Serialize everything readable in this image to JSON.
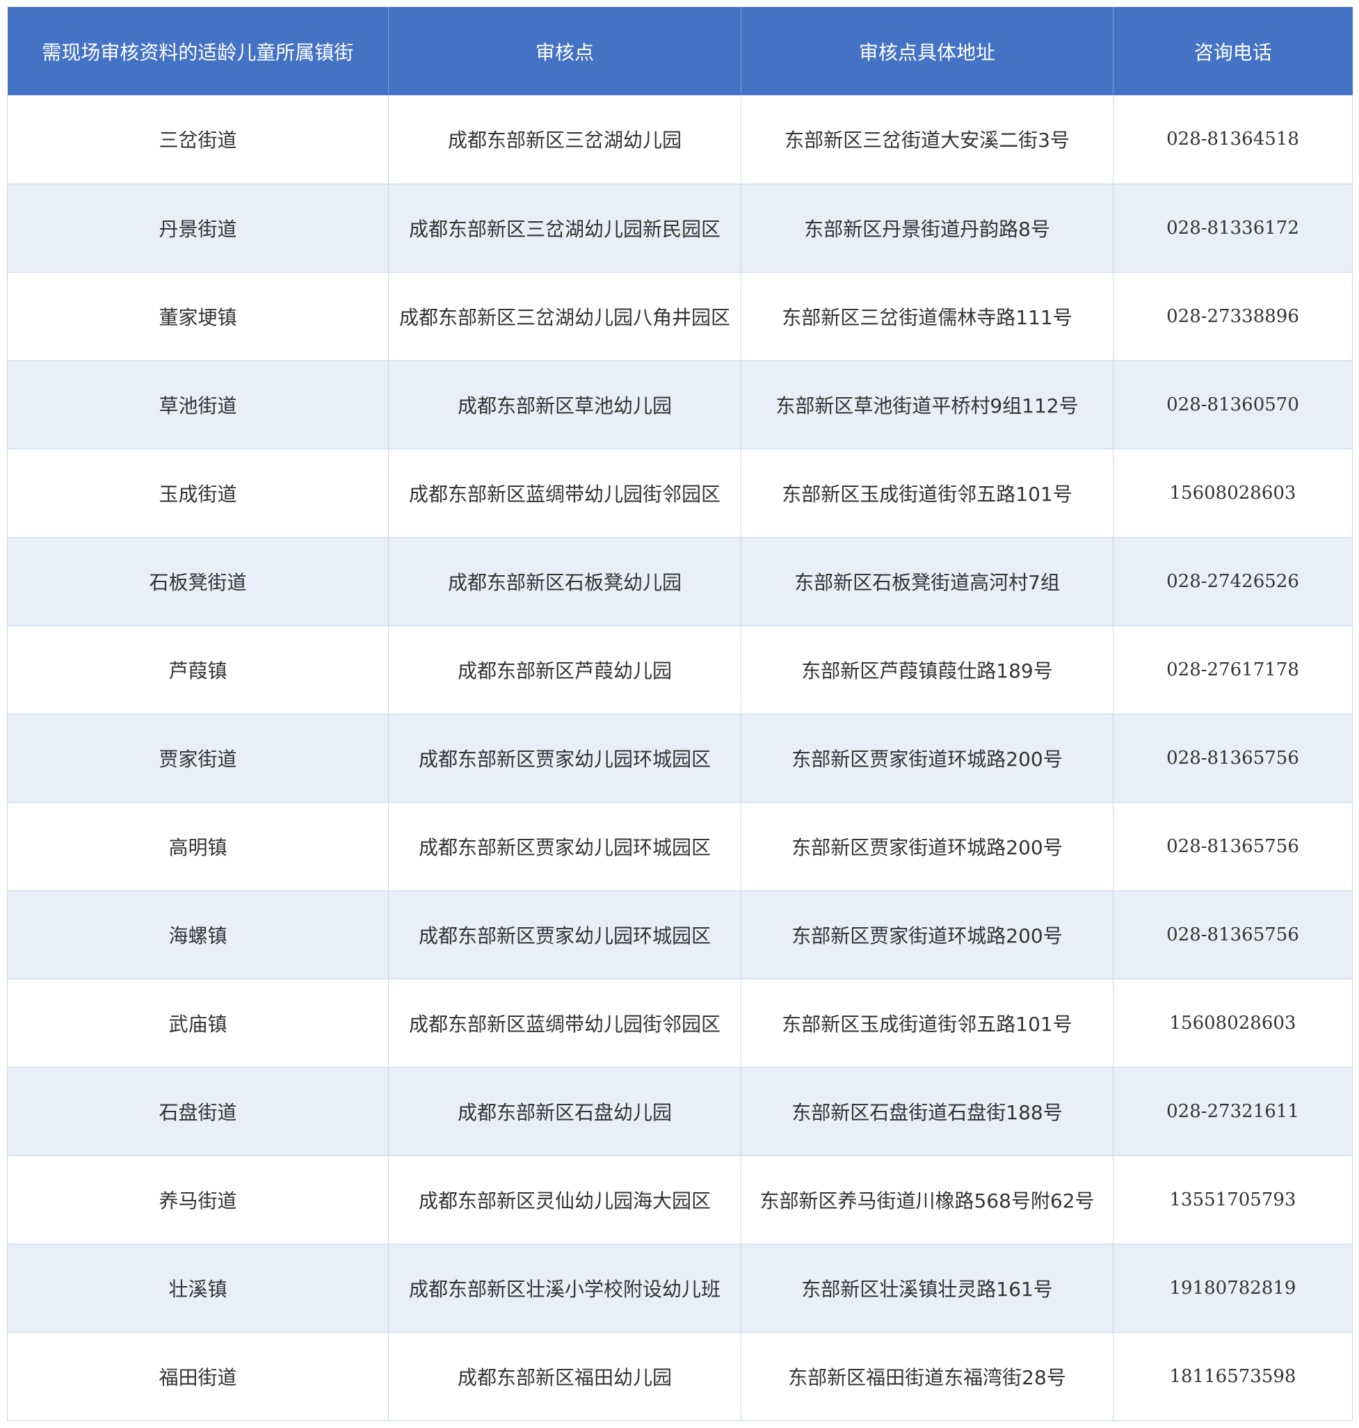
{
  "table": {
    "headers": [
      "需现场审核资料的适龄儿童所属镇街",
      "审核点",
      "审核点具体地址",
      "咨询电话"
    ],
    "rows": [
      {
        "town": "三岔街道",
        "site": "成都东部新区三岔湖幼儿园",
        "address": "东部新区三岔街道大安溪二街3号",
        "phone": "028-81364518"
      },
      {
        "town": "丹景街道",
        "site": "成都东部新区三岔湖幼儿园新民园区",
        "address": "东部新区丹景街道丹韵路8号",
        "phone": "028-81336172"
      },
      {
        "town": "董家埂镇",
        "site": "成都东部新区三岔湖幼儿园八角井园区",
        "address": "东部新区三岔街道儒林寺路111号",
        "phone": "028-27338896"
      },
      {
        "town": "草池街道",
        "site": "成都东部新区草池幼儿园",
        "address": "东部新区草池街道平桥村9组112号",
        "phone": "028-81360570"
      },
      {
        "town": "玉成街道",
        "site": "成都东部新区蓝绸带幼儿园街邻园区",
        "address": "东部新区玉成街道街邻五路101号",
        "phone": "15608028603"
      },
      {
        "town": "石板凳街道",
        "site": "成都东部新区石板凳幼儿园",
        "address": "东部新区石板凳街道高河村7组",
        "phone": "028-27426526"
      },
      {
        "town": "芦葭镇",
        "site": "成都东部新区芦葭幼儿园",
        "address": "东部新区芦葭镇葭仕路189号",
        "phone": "028-27617178"
      },
      {
        "town": "贾家街道",
        "site": "成都东部新区贾家幼儿园环城园区",
        "address": "东部新区贾家街道环城路200号",
        "phone": "028-81365756"
      },
      {
        "town": "高明镇",
        "site": "成都东部新区贾家幼儿园环城园区",
        "address": "东部新区贾家街道环城路200号",
        "phone": "028-81365756"
      },
      {
        "town": "海螺镇",
        "site": "成都东部新区贾家幼儿园环城园区",
        "address": "东部新区贾家街道环城路200号",
        "phone": "028-81365756"
      },
      {
        "town": "武庙镇",
        "site": "成都东部新区蓝绸带幼儿园街邻园区",
        "address": "东部新区玉成街道街邻五路101号",
        "phone": "15608028603"
      },
      {
        "town": "石盘街道",
        "site": "成都东部新区石盘幼儿园",
        "address": "东部新区石盘街道石盘街188号",
        "phone": "028-27321611"
      },
      {
        "town": "养马街道",
        "site": "成都东部新区灵仙幼儿园海大园区",
        "address": "东部新区养马街道川橡路568号附62号",
        "phone": "13551705793"
      },
      {
        "town": "壮溪镇",
        "site": "成都东部新区壮溪小学校附设幼儿班",
        "address": "东部新区壮溪镇壮灵路161号",
        "phone": "19180782819"
      },
      {
        "town": "福田街道",
        "site": "成都东部新区福田幼儿园",
        "address": "东部新区福田街道东福湾街28号",
        "phone": "18116573598"
      }
    ]
  },
  "colors": {
    "header_bg": "#4472c4",
    "header_text": "#ffffff",
    "row_alt_bg": "#e9eef8",
    "border": "#c9d5ec",
    "text": "#333333"
  }
}
